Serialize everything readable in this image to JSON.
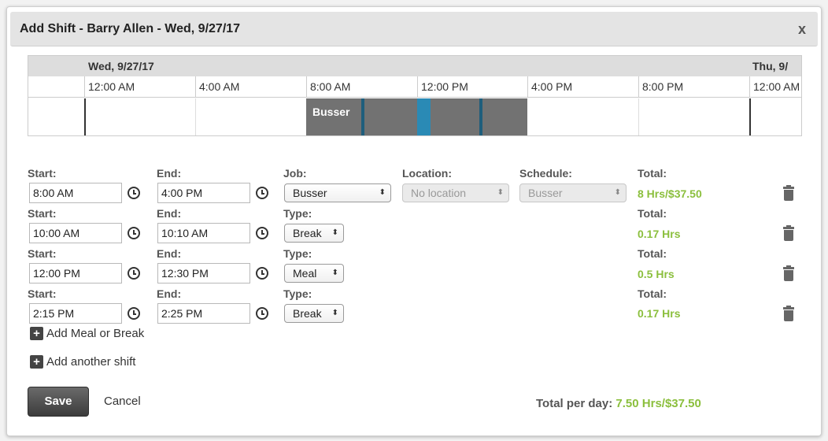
{
  "dialog": {
    "title": "Add Shift - Barry Allen - Wed, 9/27/17",
    "close_label": "x"
  },
  "timeline": {
    "days": [
      "Wed, 9/27/17",
      "Thu, 9/"
    ],
    "hours": [
      "12:00 AM",
      "4:00 AM",
      "8:00 AM",
      "12:00 PM",
      "4:00 PM",
      "8:00 PM",
      "12:00 AM"
    ],
    "shift_label": "Busser",
    "colors": {
      "shift": "#727272",
      "break": "#2a8ab5",
      "day_header": "#dddddd"
    }
  },
  "headers": {
    "start": "Start:",
    "end": "End:",
    "job": "Job:",
    "type": "Type:",
    "location": "Location:",
    "schedule": "Schedule:",
    "total": "Total:"
  },
  "shift": {
    "start": "8:00 AM",
    "end": "4:00 PM",
    "job": "Busser",
    "location": "No location",
    "schedule": "Busser",
    "total": "8 Hrs/$37.50"
  },
  "breaks": [
    {
      "start": "10:00 AM",
      "end": "10:10 AM",
      "type": "Break",
      "total": "0.17 Hrs"
    },
    {
      "start": "12:00 PM",
      "end": "12:30 PM",
      "type": "Meal",
      "total": "0.5 Hrs"
    },
    {
      "start": "2:15 PM",
      "end": "2:25 PM",
      "type": "Break",
      "total": "0.17 Hrs"
    }
  ],
  "actions": {
    "add_meal_break": "Add Meal or Break",
    "add_shift": "Add another shift",
    "save": "Save",
    "cancel": "Cancel"
  },
  "footer": {
    "total_label": "Total per day:",
    "total_value": "7.50 Hrs/$37.50"
  },
  "icons": {
    "clock": "clock-icon",
    "trash": "trash-icon",
    "plus": "plus-icon",
    "close": "close-icon"
  },
  "colors": {
    "accent_green": "#8bbf3d",
    "titlebar": "#e4e4e4"
  }
}
